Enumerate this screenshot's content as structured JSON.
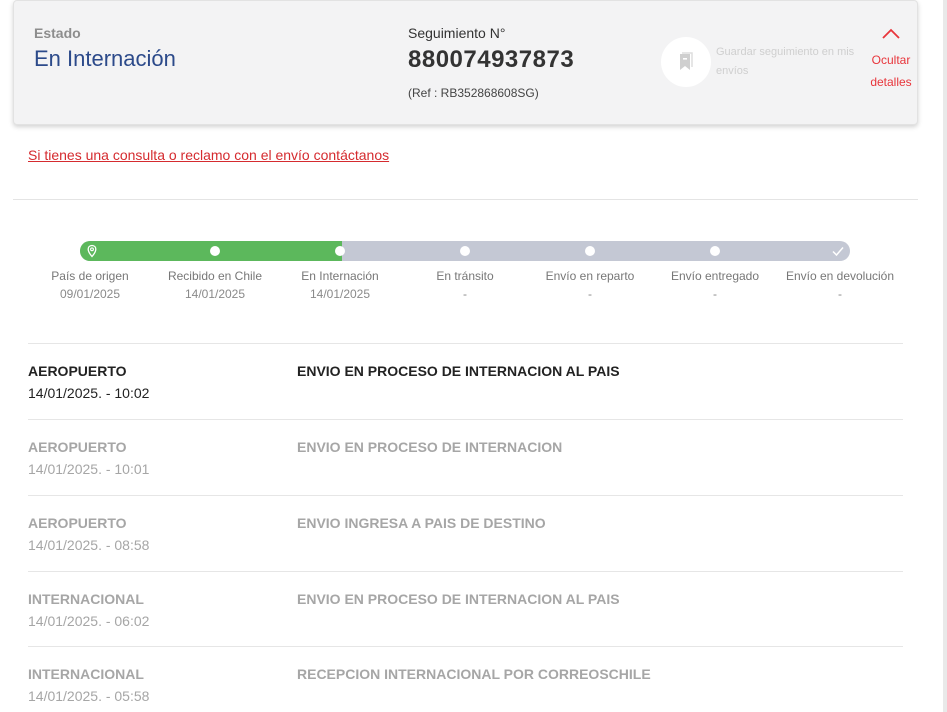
{
  "header": {
    "estado_label": "Estado",
    "estado_value": "En Internación",
    "seguimiento_label": "Seguimiento N°",
    "seguimiento_number": "880074937873",
    "reference": "(Ref : RB352868608SG)",
    "save_text": "Guardar seguimiento en mis envíos",
    "save_icon": "bookmark-icon",
    "hide_label_line1": "Ocultar",
    "hide_label_line2": "detalles",
    "hide_icon": "chevron-up-icon"
  },
  "contact_link": "Si tienes una consulta o reclamo con el envío contáctanos",
  "progress": {
    "completed_fraction": 0.34,
    "colors": {
      "done": "#5cb85c",
      "pending": "#c4c8d4",
      "accent": "#d52b2f"
    },
    "steps": [
      {
        "label": "País de origen",
        "date": "09/01/2025",
        "icon": "location-pin-icon"
      },
      {
        "label": "Recibido en Chile",
        "date": "14/01/2025",
        "icon": "dot"
      },
      {
        "label": "En Internación",
        "date": "14/01/2025",
        "icon": "dot"
      },
      {
        "label": "En tránsito",
        "date": "-",
        "icon": "dot"
      },
      {
        "label": "Envío en reparto",
        "date": "-",
        "icon": "dot"
      },
      {
        "label": "Envío entregado",
        "date": "-",
        "icon": "dot"
      },
      {
        "label": "Envío en devolución",
        "date": "-",
        "icon": "check-icon"
      }
    ]
  },
  "events": [
    {
      "place": "AEROPUERTO",
      "datetime": "14/01/2025. - 10:02",
      "description": "ENVIO EN PROCESO DE INTERNACION AL PAIS"
    },
    {
      "place": "AEROPUERTO",
      "datetime": "14/01/2025. - 10:01",
      "description": "ENVIO EN PROCESO DE INTERNACION"
    },
    {
      "place": "AEROPUERTO",
      "datetime": "14/01/2025. - 08:58",
      "description": "ENVIO INGRESA A PAIS DE DESTINO"
    },
    {
      "place": "INTERNACIONAL",
      "datetime": "14/01/2025. - 06:02",
      "description": "ENVIO EN PROCESO DE INTERNACION AL PAIS"
    },
    {
      "place": "INTERNACIONAL",
      "datetime": "14/01/2025. - 05:58",
      "description": "RECEPCION INTERNACIONAL POR CORREOSCHILE"
    }
  ]
}
